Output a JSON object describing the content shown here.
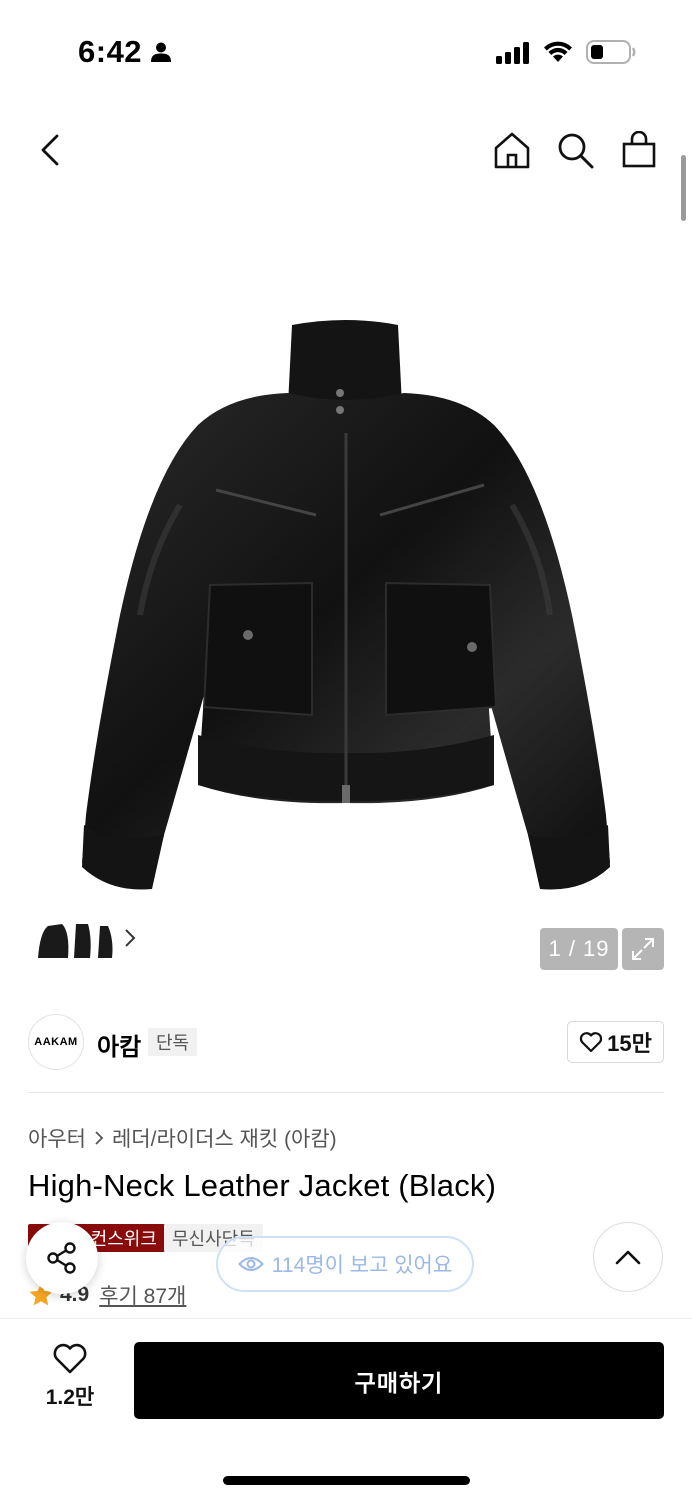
{
  "status_bar": {
    "time": "6:42",
    "icons": [
      "person-icon",
      "signal-icon",
      "wifi-icon",
      "battery-icon"
    ]
  },
  "header": {
    "icons": [
      "back-icon",
      "home-icon",
      "search-icon",
      "bag-icon"
    ]
  },
  "gallery": {
    "counter": "1 / 19",
    "current": 1,
    "total": 19
  },
  "brand": {
    "logo_text": "AAKAM",
    "name": "아캄",
    "exclusive_tag": "단독",
    "like_count": "15만"
  },
  "breadcrumb": {
    "category": "아우터",
    "subcategory": "레더/라이더스 재킷 (아캄)"
  },
  "product": {
    "title": "High-Neck Leather Jacket (Black)",
    "tag_red": "무신사 컨스위크",
    "tag_gray": "무신사단독",
    "rating": "4.9",
    "reviews": "후기 87개"
  },
  "floating": {
    "viewers": "114명이 보고 있어요"
  },
  "bottom_bar": {
    "like_count": "1.2만",
    "buy_label": "구매하기"
  },
  "colors": {
    "tag_red": "#8a0b0b",
    "star": "#f5a623",
    "viewers_text": "#9bb8e6",
    "buy_button": "#000000"
  }
}
